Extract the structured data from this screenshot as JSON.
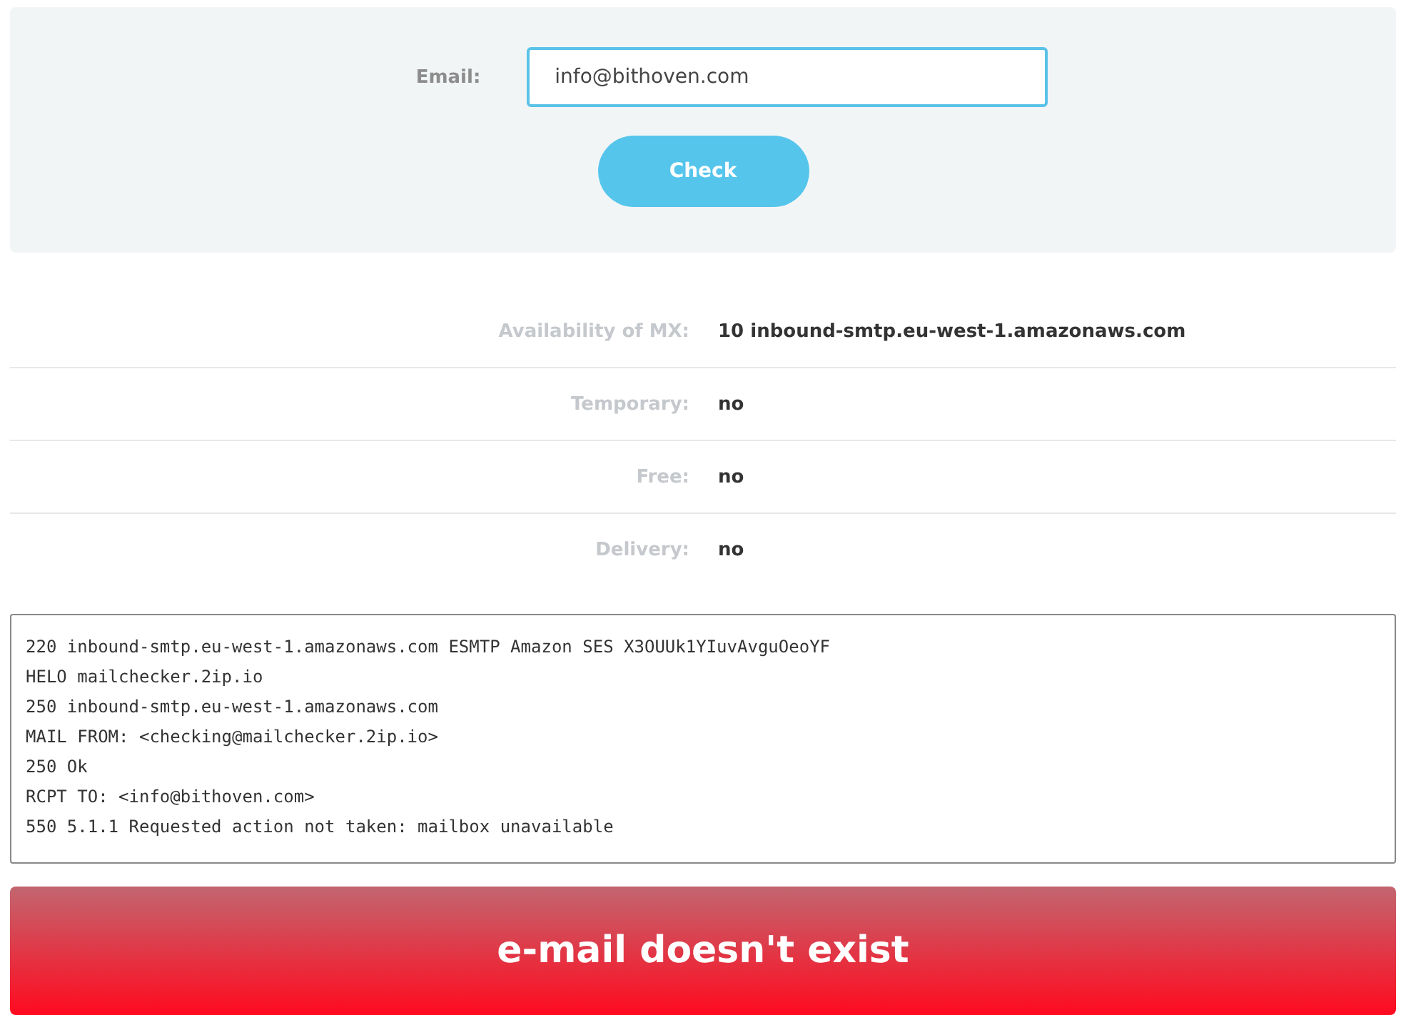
{
  "form": {
    "label": "Email:",
    "value": "info@bithoven.com",
    "button": "Check"
  },
  "results": [
    {
      "label": "Availability of MX:",
      "value": "**10** inbound-smtp.eu-west-1.amazonaws.com"
    },
    {
      "label": "Temporary:",
      "value": "no"
    },
    {
      "label": "Free:",
      "value": "no"
    },
    {
      "label": "Delivery:",
      "value": "no"
    }
  ],
  "log": [
    "220 inbound-smtp.eu-west-1.amazonaws.com ESMTP Amazon SES X3OUUk1YIuvAvguOeoYF",
    "HELO mailchecker.2ip.io",
    "250 inbound-smtp.eu-west-1.amazonaws.com",
    "MAIL FROM: <checking@mailchecker.2ip.io>",
    "250 Ok",
    "RCPT TO: <info@bithoven.com>",
    "550 5.1.1 Requested action not taken: mailbox unavailable"
  ],
  "verdict": "e-mail doesn't exist"
}
